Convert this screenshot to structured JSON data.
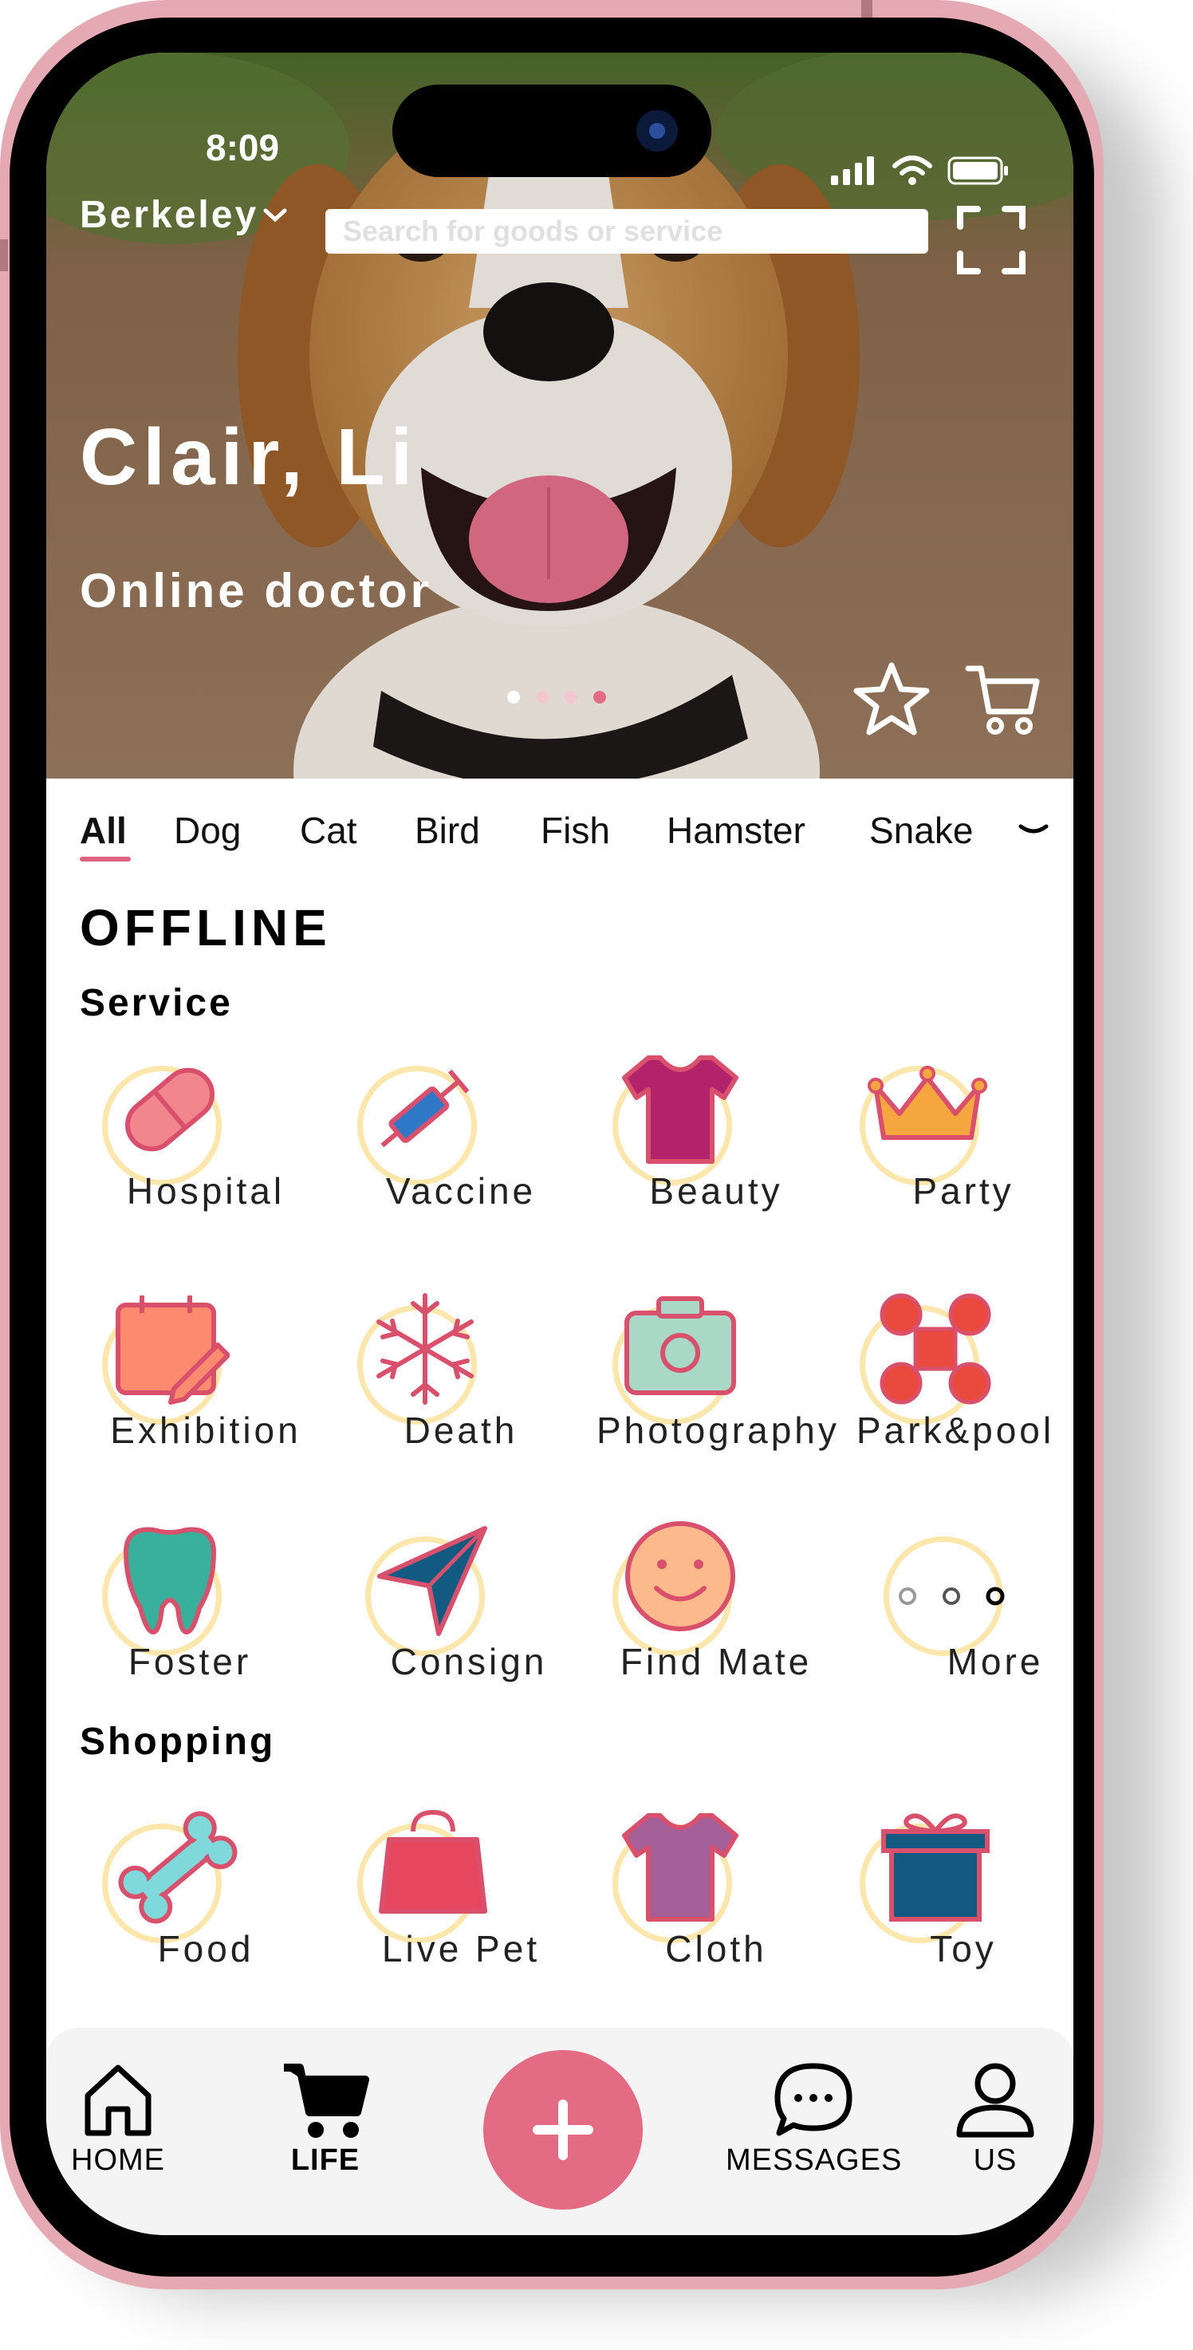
{
  "status": {
    "time": "8:09"
  },
  "header": {
    "location": "Berkeley",
    "search_placeholder": "Search for goods or service"
  },
  "banner": {
    "title": "Clair, Li",
    "subtitle": "Online doctor",
    "slides": 4,
    "active_slide": 4
  },
  "tabs": [
    "All",
    "Dog",
    "Cat",
    "Bird",
    "Fish",
    "Hamster",
    "Snake"
  ],
  "sections": {
    "offline": "OFFLINE",
    "service": "Service",
    "shopping": "Shopping"
  },
  "service_items": [
    {
      "label": "Hospital",
      "icon": "pill-icon"
    },
    {
      "label": "Vaccine",
      "icon": "syringe-icon"
    },
    {
      "label": "Beauty",
      "icon": "shirt-icon"
    },
    {
      "label": "Party",
      "icon": "crown-icon"
    },
    {
      "label": "Exhibition",
      "icon": "calendar-icon"
    },
    {
      "label": "Death",
      "icon": "snowflake-icon"
    },
    {
      "label": "Photography",
      "icon": "camera-icon"
    },
    {
      "label": "Park&pool",
      "icon": "command-icon"
    },
    {
      "label": "Foster",
      "icon": "tooth-icon"
    },
    {
      "label": "Consign",
      "icon": "paper-plane-icon"
    },
    {
      "label": "Find Mate",
      "icon": "smile-icon"
    },
    {
      "label": "More",
      "icon": "more-icon"
    }
  ],
  "shopping_items": [
    {
      "label": "Food",
      "icon": "bone-icon"
    },
    {
      "label": "Live Pet",
      "icon": "bag-icon"
    },
    {
      "label": "Cloth",
      "icon": "tshirt-icon"
    },
    {
      "label": "Toy",
      "icon": "gift-icon"
    }
  ],
  "nav": {
    "home": "HOME",
    "life": "LIFE",
    "messages": "MESSAGES",
    "us": "US"
  },
  "colors": {
    "accent": "#e36b84",
    "ring": "#fbe6ac",
    "phone_frame": "#e5a9b4"
  }
}
